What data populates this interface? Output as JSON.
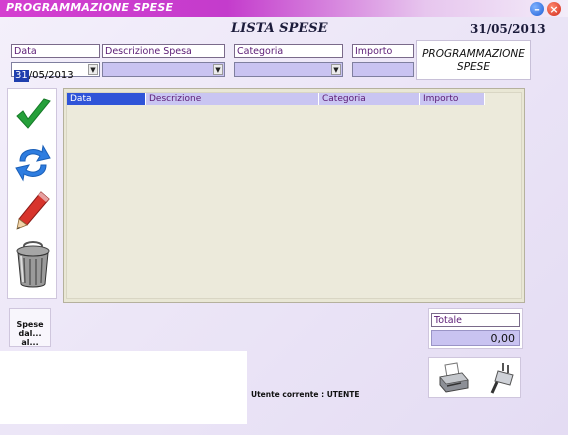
{
  "window": {
    "title": "PROGRAMMAZIONE SPESE",
    "minimize_icon": "minus-icon",
    "close_icon": "close-x-icon"
  },
  "header": {
    "heading": "LISTA SPESE",
    "date": "31/05/2013"
  },
  "filters": {
    "data": {
      "label": "Data",
      "value_day": "31",
      "value_rest": "/05/2013"
    },
    "descrizione": {
      "label": "Descrizione Spesa",
      "value": ""
    },
    "categoria": {
      "label": "Categoria",
      "value": ""
    },
    "importo": {
      "label": "Importo",
      "value": ""
    }
  },
  "program_label": {
    "line1": "PROGRAMMAZIONE",
    "line2": "SPESE"
  },
  "toolbar": {
    "icons": [
      "checkmark-icon",
      "refresh-icon",
      "pencil-icon",
      "trash-icon"
    ]
  },
  "table": {
    "columns": [
      "Data",
      "Descrizione",
      "Categoria",
      "Importo"
    ],
    "rows": []
  },
  "spese_button": {
    "line1": "Spese",
    "line2": "dal... al..."
  },
  "totale": {
    "label": "Totale",
    "value": "0,00"
  },
  "status": {
    "user_text": "Utente corrente : UTENTE"
  },
  "devices": {
    "icons": [
      "printer-icon",
      "plug-icon"
    ]
  },
  "colors": {
    "titlebar": "#d43fd0",
    "accent": "#2f54d8",
    "field": "#c9c3f1",
    "label_text": "#5b1b75"
  }
}
